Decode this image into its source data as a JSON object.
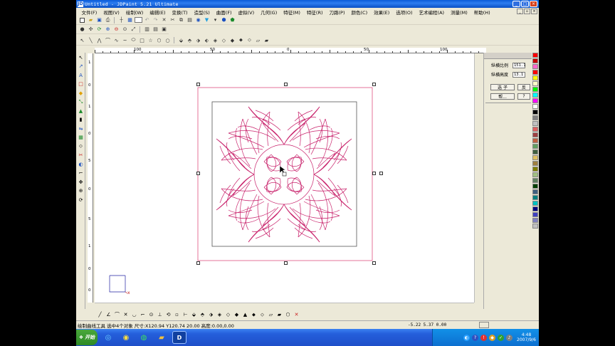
{
  "window": {
    "title": "Untitled - JDPaint 5.21 Ultimate",
    "app_icon": "JD"
  },
  "menu": {
    "items": [
      "文件(F)",
      "视图(V)",
      "绘制(W)",
      "编辑(E)",
      "变换(T)",
      "造型(S)",
      "曲面(F)",
      "虚拟(V)",
      "几何(G)",
      "特征(M)",
      "特征(R)",
      "刀路(P)",
      "颜色(C)",
      "效果(E)",
      "选项(O)",
      "艺术编程(A)",
      "测量(M)",
      "帮助(H)"
    ]
  },
  "ruler": {
    "top_ticks": [
      "100",
      "50",
      "0",
      "50",
      "100"
    ],
    "left_ticks": [
      "1",
      "0",
      "1",
      "0",
      "5",
      "0",
      "5",
      "1",
      "0",
      "0"
    ]
  },
  "right_panel": {
    "title": "",
    "rows": [
      {
        "label": "纵横比例",
        "value": "151.1"
      },
      {
        "label": "纵横高度",
        "value": "13.1"
      }
    ],
    "btn_select": "选 子",
    "btn_select_suffix": "反",
    "btn_help": "帮...",
    "btn_help_suffix": "?"
  },
  "palette": [
    "#ff0000",
    "#c80000",
    "#ff66cc",
    "#ff0000",
    "#ffff00",
    "#ffffc8",
    "#00ff00",
    "#00ffff",
    "#ff00ff",
    "#ffffff",
    "#000000",
    "#808080",
    "#c0c0c0",
    "#e06060",
    "#a04040",
    "#c06040",
    "#60a060",
    "#406040",
    "#e0c060",
    "#a08040",
    "#808000",
    "#a0c080",
    "#608060",
    "#004000",
    "#406080",
    "#008080",
    "#00c0c0",
    "#000080",
    "#4040c0",
    "#8080c0",
    "#c0c0c0"
  ],
  "status": {
    "main": "绘制曲线工具 选中4个对象 尺寸:X120.94 Y120.74 20.00 高度:0.00,0.00",
    "coords": "-5.22 5.37 0.00"
  },
  "taskbar": {
    "start_label": "开始",
    "clock_time": "4:48",
    "clock_date": "2007/9/6"
  },
  "colors": {
    "drawing_stroke": "#c8206a",
    "frame_stroke": "#555555",
    "selection_border": "#e05080",
    "axis_y": "#2020a0",
    "axis_x": "#c02020"
  },
  "icons": {
    "new": "new-file-icon",
    "open": "open-folder-icon",
    "save": "save-icon",
    "close_x": "close-icon"
  }
}
